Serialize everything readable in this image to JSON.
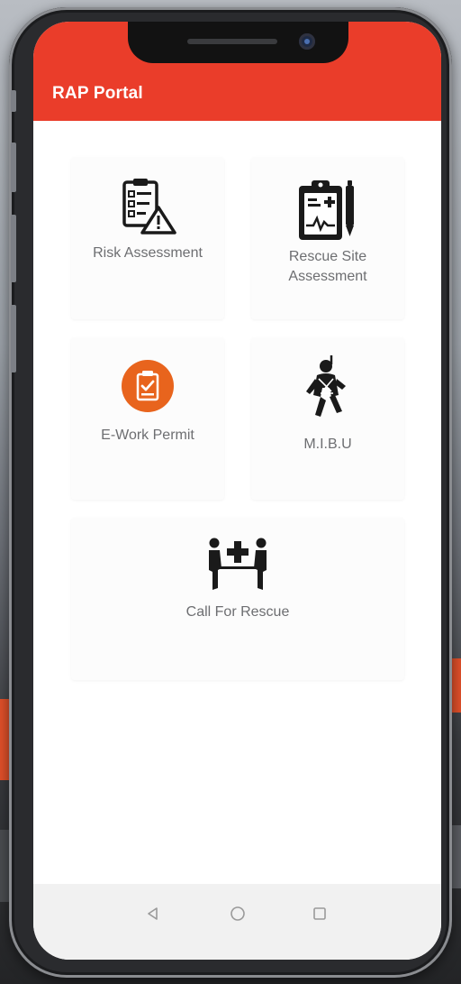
{
  "app": {
    "title": "RAP Portal"
  },
  "tiles": [
    {
      "label": "Risk Assessment",
      "icon": "checklist-warning-icon"
    },
    {
      "label": "Rescue Site\nAssessment",
      "icon": "clipboard-medical-pen-icon"
    },
    {
      "label": "E-Work Permit",
      "icon": "permit-clipboard-icon",
      "accent": "#e8641d"
    },
    {
      "label": "M.I.B.U",
      "icon": "harness-worker-icon"
    },
    {
      "label": "Call For Rescue",
      "icon": "stretcher-rescue-icon"
    }
  ],
  "nav": {
    "back": "back-icon",
    "home": "home-icon",
    "recent": "recent-apps-icon"
  },
  "colors": {
    "app_bar": "#ea3d2a",
    "label": "#6d6e71",
    "accent": "#e8641d"
  }
}
